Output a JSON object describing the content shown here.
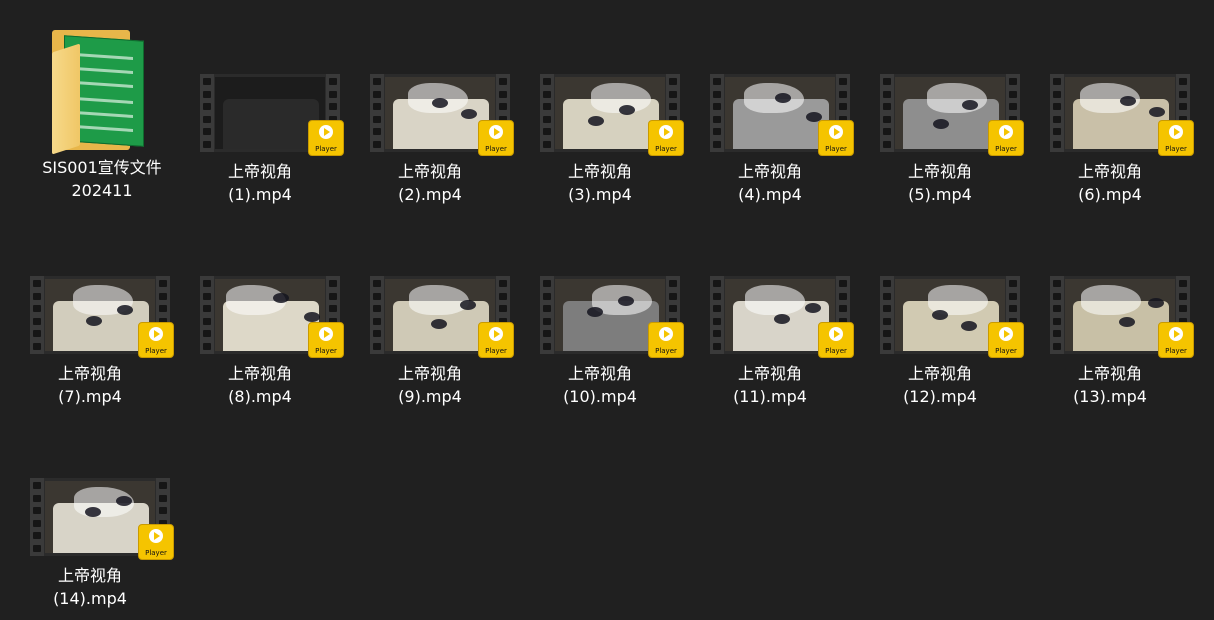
{
  "folder": {
    "name_line1": "SIS001宣传文件",
    "name_line2": "202411",
    "icon": "folder-icon"
  },
  "badge_text": "Player",
  "files": [
    {
      "line1": "上帝视角",
      "line2": "(1).mp4"
    },
    {
      "line1": "上帝视角",
      "line2": "(2).mp4"
    },
    {
      "line1": "上帝视角",
      "line2": "(3).mp4"
    },
    {
      "line1": "上帝视角",
      "line2": "(4).mp4"
    },
    {
      "line1": "上帝视角",
      "line2": "(5).mp4"
    },
    {
      "line1": "上帝视角",
      "line2": "(6).mp4"
    },
    {
      "line1": "上帝视角",
      "line2": "(7).mp4"
    },
    {
      "line1": "上帝视角",
      "line2": "(8).mp4"
    },
    {
      "line1": "上帝视角",
      "line2": "(9).mp4"
    },
    {
      "line1": "上帝视角",
      "line2": "(10).mp4"
    },
    {
      "line1": "上帝视角",
      "line2": "(11).mp4"
    },
    {
      "line1": "上帝视角",
      "line2": "(12).mp4"
    },
    {
      "line1": "上帝视角",
      "line2": "(13).mp4"
    },
    {
      "line1": "上帝视角",
      "line2": "(14).mp4"
    }
  ],
  "colors": {
    "background": "#202020",
    "badge": "#f5c400",
    "text": "#ffffff"
  }
}
